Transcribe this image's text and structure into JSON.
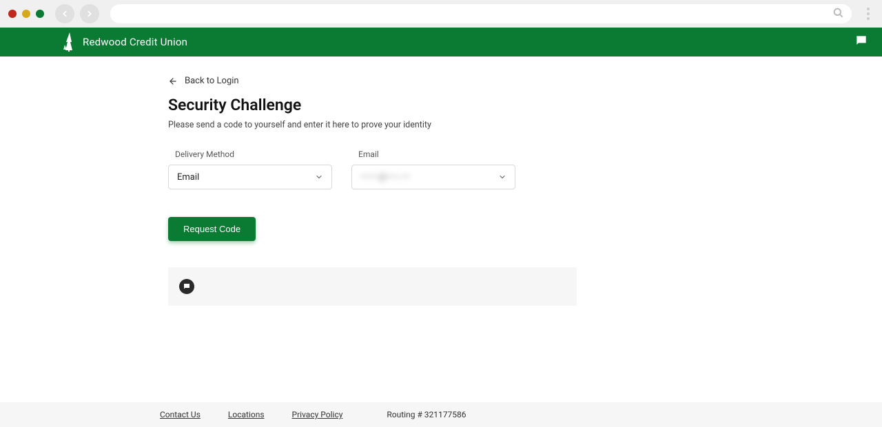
{
  "brand": {
    "name": "Redwood Credit Union",
    "primary_color": "#0b7b34"
  },
  "back_link": "Back to Login",
  "page": {
    "title": "Security Challenge",
    "subtitle": "Please send a code to yourself and enter it here to prove your identity"
  },
  "form": {
    "delivery_method": {
      "label": "Delivery Method",
      "value": "Email"
    },
    "email": {
      "label": "Email",
      "value": "••••••@••••.•••"
    },
    "request_button": "Request Code"
  },
  "footer": {
    "links": {
      "contact": "Contact Us",
      "locations": "Locations",
      "privacy": "Privacy Policy"
    },
    "routing": "Routing # 321177586"
  }
}
